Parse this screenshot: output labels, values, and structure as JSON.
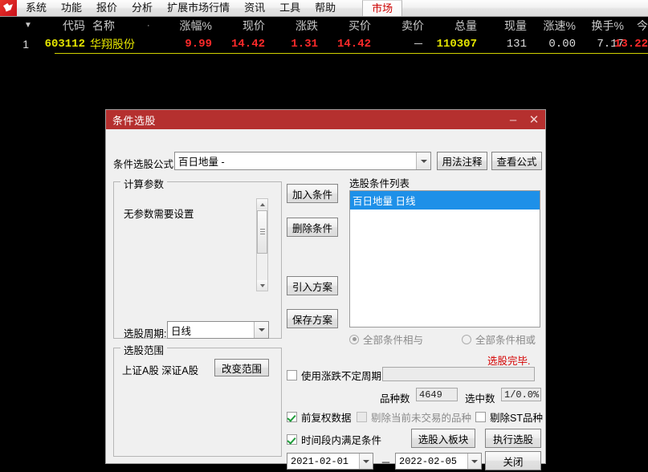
{
  "menu": {
    "logo_icon": "app-logo-icon",
    "items": [
      "系统",
      "功能",
      "报价",
      "分析",
      "扩展市场行情",
      "资讯",
      "工具",
      "帮助"
    ],
    "market_tab": "市场"
  },
  "quote": {
    "columns": [
      "代码",
      "名称",
      "涨幅%",
      "现价",
      "涨跌",
      "买价",
      "卖价",
      "总量",
      "现量",
      "涨速%",
      "换手%",
      "今开"
    ],
    "sort_icon": "sort-down-icon",
    "dot_icon": "dot-icon",
    "row": {
      "index": "1",
      "code": "603112",
      "name": "华翔股份",
      "change_pct": "9.99",
      "price": "14.42",
      "change": "1.31",
      "bid": "14.42",
      "ask": "－",
      "volume": "110307",
      "now_volume": "131",
      "speed_pct": "0.00",
      "turnover_pct": "7.17",
      "open": "13.22"
    },
    "colors": {
      "header_text": "#c9c9c9",
      "code": "#e6e600",
      "name": "#e6e600",
      "up": "#ff2a2a",
      "volume": "#e6e600",
      "neutral": "#dcdcdc",
      "underline": "#d2d200"
    }
  },
  "dialog": {
    "title": "条件选股",
    "minimize_icon": "minimize-icon",
    "close_icon": "close-icon",
    "formula_label": "条件选股公式",
    "formula_value": "百日地量        -",
    "usage_note_button": "用法注释",
    "view_formula_button": "查看公式",
    "calc_params": {
      "title": "计算参数",
      "text": "无参数需要设置",
      "cycle_label": "选股周期:",
      "cycle_value": "日线"
    },
    "buttons": {
      "add_condition": "加入条件",
      "delete_condition": "删除条件",
      "import_plan": "引入方案",
      "save_plan": "保存方案"
    },
    "cond_list": {
      "title": "选股条件列表",
      "items": [
        "百日地量   日线"
      ]
    },
    "logic": {
      "all_and": "全部条件相与",
      "all_or": "全部条件相或",
      "selected": "all_and"
    },
    "status_text": "选股完毕.",
    "scope": {
      "title": "选股范围",
      "value": "上证A股 深证A股",
      "change_button": "改变范围"
    },
    "use_updown_cycle": {
      "label": "使用涨跌不定周期",
      "checked": false,
      "value": ""
    },
    "counts": {
      "total_label": "品种数",
      "total_value": "4649",
      "hit_label": "选中数",
      "hit_value": "1/0.0%"
    },
    "options": [
      {
        "label": "前复权数据",
        "checked": true,
        "disabled": false
      },
      {
        "label": "剔除当前未交易的品种",
        "checked": false,
        "disabled": true
      },
      {
        "label": "剔除ST品种",
        "checked": false,
        "disabled": false
      }
    ],
    "period": {
      "label": "时间段内满足条件",
      "checked": true,
      "start": "2021-02-01",
      "separator": "－",
      "end": "2022-02-05"
    },
    "actions": {
      "add_to_block": "选股入板块",
      "run": "执行选股",
      "close": "关闭"
    }
  }
}
